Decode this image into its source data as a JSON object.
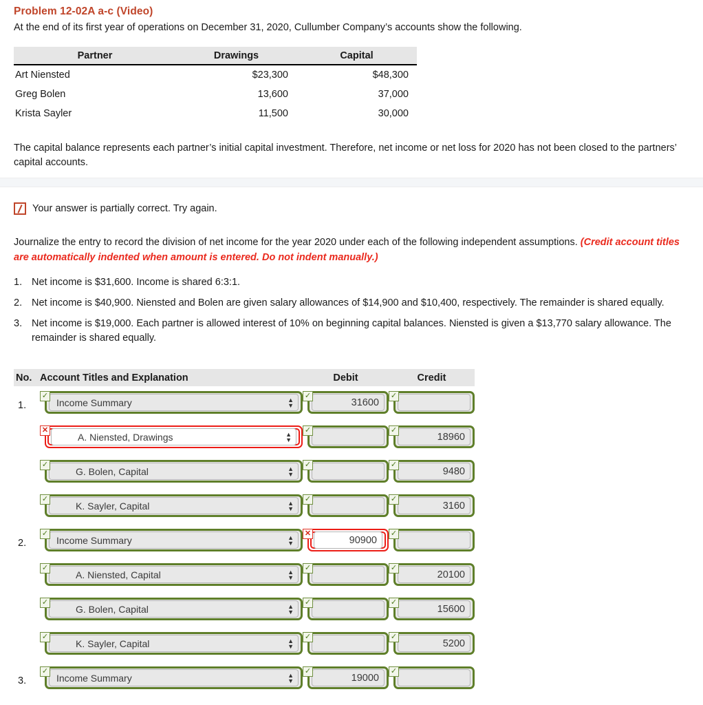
{
  "problem": {
    "title": "Problem 12-02A a-c (Video)",
    "intro": "At the end of its first year of operations on December 31, 2020, Cullumber Company’s accounts show the following.",
    "note": "The capital balance represents each partner’s initial capital investment. Therefore, net income or net loss for 2020 has not been closed to the partners’ capital accounts."
  },
  "partner_table": {
    "headers": [
      "Partner",
      "Drawings",
      "Capital"
    ],
    "rows": [
      {
        "partner": "Art Niensted",
        "drawings": "$23,300",
        "capital": "$48,300"
      },
      {
        "partner": "Greg Bolen",
        "drawings": "13,600",
        "capital": "37,000"
      },
      {
        "partner": "Krista Sayler",
        "drawings": "11,500",
        "capital": "30,000"
      }
    ]
  },
  "status": {
    "icon": "partial-correct-icon",
    "text": "Your answer is partially correct.  Try again."
  },
  "instructions": {
    "main": "Journalize the entry to record the division of net income for the year 2020 under each of the following independent assumptions. ",
    "hint": "(Credit account titles are automatically indented when amount is entered. Do not indent manually.)"
  },
  "assumptions": [
    {
      "marker": "1.",
      "text": "Net income is $31,600. Income is shared 6:3:1."
    },
    {
      "marker": "2.",
      "text": "Net income is $40,900. Niensted and Bolen are given salary allowances of $14,900 and $10,400, respectively. The remainder is shared equally."
    },
    {
      "marker": "3.",
      "text": "Net income is $19,000. Each partner is allowed interest of 10% on beginning capital balances. Niensted is given a $13,770 salary allowance. The remainder is shared equally."
    }
  ],
  "journal": {
    "headers": {
      "no": "No.",
      "account": "Account Titles and Explanation",
      "debit": "Debit",
      "credit": "Credit"
    },
    "rows": [
      {
        "no": "1.",
        "account": "Income Summary",
        "account_indent": false,
        "account_state": "correct",
        "debit": "31600",
        "debit_state": "correct",
        "credit": "",
        "credit_state": "correct"
      },
      {
        "no": "",
        "account": "A. Niensted, Drawings",
        "account_indent": true,
        "account_state": "incorrect",
        "debit": "",
        "debit_state": "correct",
        "credit": "18960",
        "credit_state": "correct"
      },
      {
        "no": "",
        "account": "G. Bolen, Capital",
        "account_indent": true,
        "account_state": "correct",
        "debit": "",
        "debit_state": "correct",
        "credit": "9480",
        "credit_state": "correct"
      },
      {
        "no": "",
        "account": "K. Sayler, Capital",
        "account_indent": true,
        "account_state": "correct",
        "debit": "",
        "debit_state": "correct",
        "credit": "3160",
        "credit_state": "correct"
      },
      {
        "no": "2.",
        "account": "Income Summary",
        "account_indent": false,
        "account_state": "correct",
        "debit": "90900",
        "debit_state": "incorrect",
        "credit": "",
        "credit_state": "correct"
      },
      {
        "no": "",
        "account": "A. Niensted, Capital",
        "account_indent": true,
        "account_state": "correct",
        "debit": "",
        "debit_state": "correct",
        "credit": "20100",
        "credit_state": "correct"
      },
      {
        "no": "",
        "account": "G. Bolen, Capital",
        "account_indent": true,
        "account_state": "correct",
        "debit": "",
        "debit_state": "correct",
        "credit": "15600",
        "credit_state": "correct"
      },
      {
        "no": "",
        "account": "K. Sayler, Capital",
        "account_indent": true,
        "account_state": "correct",
        "debit": "",
        "debit_state": "correct",
        "credit": "5200",
        "credit_state": "correct"
      },
      {
        "no": "3.",
        "account": "Income Summary",
        "account_indent": false,
        "account_state": "correct",
        "debit": "19000",
        "debit_state": "correct",
        "credit": "",
        "credit_state": "correct"
      }
    ],
    "marks": {
      "correct": "✓",
      "incorrect": "✕"
    },
    "stepper_glyph": "▲▼"
  },
  "colors": {
    "title": "#c0452a",
    "hint_red": "#ea2a1e",
    "correct_green": "#5f7f2a",
    "error_red": "#ec1c16",
    "header_band": "#e6e6e6"
  }
}
